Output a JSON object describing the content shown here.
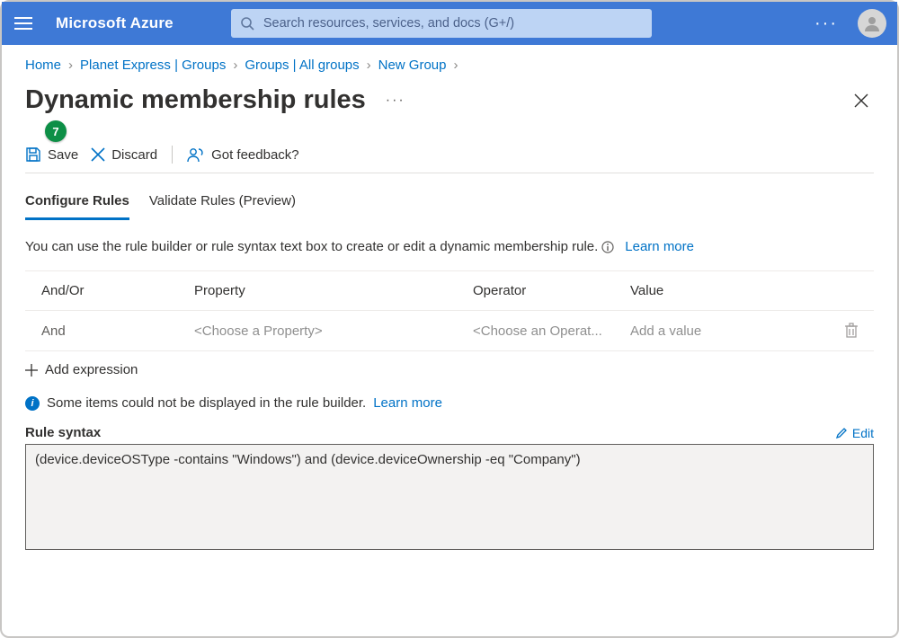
{
  "header": {
    "brand": "Microsoft Azure",
    "search_placeholder": "Search resources, services, and docs (G+/)"
  },
  "breadcrumb": {
    "items": [
      "Home",
      "Planet Express | Groups",
      "Groups | All groups",
      "New Group"
    ]
  },
  "page": {
    "title": "Dynamic membership rules",
    "step_badge": "7"
  },
  "commands": {
    "save": "Save",
    "discard": "Discard",
    "feedback": "Got feedback?"
  },
  "tabs": {
    "configure": "Configure Rules",
    "validate": "Validate Rules (Preview)"
  },
  "helper": {
    "text": "You can use the rule builder or rule syntax text box to create or edit a dynamic membership rule.",
    "learn_more": "Learn more"
  },
  "table": {
    "cols": {
      "andor": "And/Or",
      "property": "Property",
      "operator": "Operator",
      "value": "Value"
    },
    "row": {
      "andor": "And",
      "property": "<Choose a Property>",
      "operator": "<Choose an Operat...",
      "value": "Add a value"
    },
    "add": "Add expression"
  },
  "warning": {
    "text": "Some items could not be displayed in the rule builder.",
    "learn_more": "Learn more"
  },
  "syntax": {
    "label": "Rule syntax",
    "edit": "Edit",
    "content": "(device.deviceOSType -contains \"Windows\") and (device.deviceOwnership -eq \"Company\")"
  }
}
